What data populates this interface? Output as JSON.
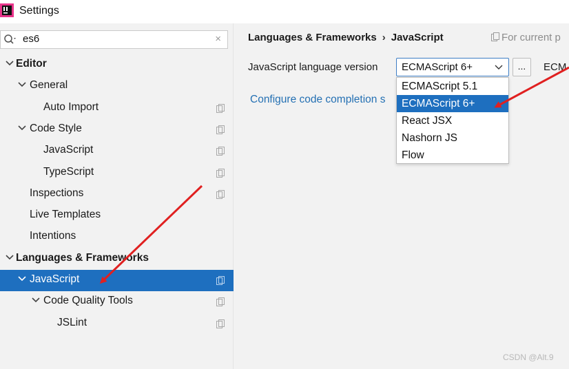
{
  "window": {
    "title": "Settings"
  },
  "search": {
    "value": "es6",
    "clear_glyph": "×"
  },
  "tree": [
    {
      "label": "Editor",
      "bold": true,
      "arrow": "down",
      "indent": 0,
      "copy": false,
      "selected": false
    },
    {
      "label": "General",
      "bold": false,
      "arrow": "down",
      "indent": 1,
      "copy": false,
      "selected": false
    },
    {
      "label": "Auto Import",
      "bold": false,
      "arrow": "none",
      "indent": 2,
      "copy": true,
      "selected": false
    },
    {
      "label": "Code Style",
      "bold": false,
      "arrow": "down",
      "indent": 1,
      "copy": true,
      "selected": false
    },
    {
      "label": "JavaScript",
      "bold": false,
      "arrow": "none",
      "indent": 2,
      "copy": true,
      "selected": false
    },
    {
      "label": "TypeScript",
      "bold": false,
      "arrow": "none",
      "indent": 2,
      "copy": true,
      "selected": false
    },
    {
      "label": "Inspections",
      "bold": false,
      "arrow": "none",
      "indent": 1,
      "copy": true,
      "selected": false
    },
    {
      "label": "Live Templates",
      "bold": false,
      "arrow": "none",
      "indent": 1,
      "copy": false,
      "selected": false
    },
    {
      "label": "Intentions",
      "bold": false,
      "arrow": "none",
      "indent": 1,
      "copy": false,
      "selected": false
    },
    {
      "label": "Languages & Frameworks",
      "bold": true,
      "arrow": "down",
      "indent": 0,
      "copy": false,
      "selected": false
    },
    {
      "label": "JavaScript",
      "bold": false,
      "arrow": "down",
      "indent": 1,
      "copy": true,
      "selected": true
    },
    {
      "label": "Code Quality Tools",
      "bold": false,
      "arrow": "down",
      "indent": 2,
      "copy": true,
      "selected": false
    },
    {
      "label": "JSLint",
      "bold": false,
      "arrow": "none",
      "indent": 3,
      "copy": true,
      "selected": false
    }
  ],
  "breadcrumb": {
    "parent": "Languages & Frameworks",
    "separator": "›",
    "current": "JavaScript"
  },
  "scope_hint": "For current p",
  "language_version": {
    "label": "JavaScript language version",
    "selected": "ECMAScript 6+",
    "button_label": "...",
    "trailing_text": "ECM"
  },
  "config_link": "Configure code completion s",
  "dropdown": {
    "options": [
      "ECMAScript 5.1",
      "ECMAScript 6+",
      "React JSX",
      "Nashorn JS",
      "Flow"
    ],
    "highlighted_index": 1
  },
  "watermark": "CSDN @Alt.9",
  "colors": {
    "selection": "#1e6fbf",
    "link": "#2470b3",
    "annotation_arrow": "#e02020"
  },
  "icons": [
    "app-logo-icon",
    "search-icon",
    "clear-icon",
    "chevron-down-icon",
    "copy-settings-icon",
    "page-icon"
  ]
}
